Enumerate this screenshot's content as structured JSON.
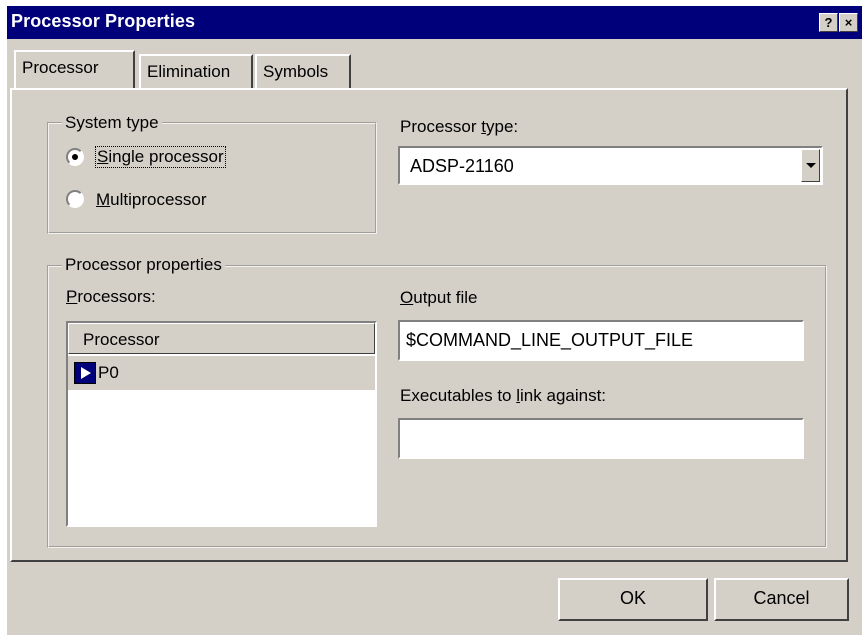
{
  "window": {
    "title": "Processor Properties",
    "help_glyph": "?",
    "close_glyph": "×"
  },
  "tabs": [
    {
      "label": "Processor",
      "active": true
    },
    {
      "label": "Elimination",
      "active": false
    },
    {
      "label": "Symbols",
      "active": false
    }
  ],
  "system_type": {
    "legend": "System type",
    "options": [
      {
        "label": "Single processor",
        "mnemonic": "S",
        "rest": "ingle processor",
        "selected": true
      },
      {
        "label": "Multiprocessor",
        "mnemonic": "M",
        "rest": "ultiprocessor",
        "selected": false
      }
    ]
  },
  "processor_type": {
    "label_before": "Processor ",
    "label_mnemonic": "t",
    "label_after": "ype:",
    "value": "ADSP-21160"
  },
  "processor_properties": {
    "legend": "Processor properties",
    "processors_label_mnemonic": "P",
    "processors_label_rest": "rocessors:",
    "list_header": "Processor",
    "processors": [
      {
        "name": "P0",
        "icon": "play-arrow-icon"
      }
    ],
    "output_label_mnemonic": "O",
    "output_label_rest": "utput file",
    "output_value": "$COMMAND_LINE_OUTPUT_FILE",
    "exec_label_before": "Executables to ",
    "exec_label_mnemonic": "l",
    "exec_label_after": "ink against:",
    "exec_value": ""
  },
  "buttons": {
    "ok": "OK",
    "cancel": "Cancel"
  },
  "colors": {
    "titlebar": "#00007b",
    "face": "#d4d0c8",
    "selection_icon": "#00007b"
  }
}
